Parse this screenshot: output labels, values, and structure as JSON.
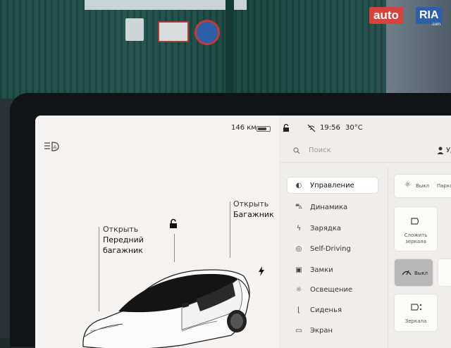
{
  "status_bar": {
    "range": "146 км",
    "battery_level": 0.75,
    "time": "19:56",
    "temperature": "30°C"
  },
  "left_panel": {
    "frunk_label_line1": "Открыть",
    "frunk_label_line2": "Передний",
    "frunk_label_line3": "багажник",
    "trunk_label_line1": "Открыть",
    "trunk_label_line2": "Багажник"
  },
  "right_panel": {
    "search_placeholder": "Поиск",
    "profile_label": "Уд",
    "menu": [
      {
        "icon": "toggle-icon",
        "label": "Управление",
        "active": true
      },
      {
        "icon": "car-icon",
        "label": "Динамика",
        "active": false
      },
      {
        "icon": "bolt-icon",
        "label": "Зарядка",
        "active": false
      },
      {
        "icon": "steering-wheel-icon",
        "label": "Self-Driving",
        "active": false
      },
      {
        "icon": "lock-icon",
        "label": "Замки",
        "active": false
      },
      {
        "icon": "sun-icon",
        "label": "Освещение",
        "active": false
      },
      {
        "icon": "seat-icon",
        "label": "Сиденья",
        "active": false
      },
      {
        "icon": "display-icon",
        "label": "Экран",
        "active": false
      }
    ],
    "cards": {
      "lights_off": "Выкл",
      "parking": "Парков",
      "fold_mirrors_line1": "Сложить",
      "fold_mirrors_line2": "зеркала",
      "wipers_off": "Выкл",
      "mirrors": "Зеркала"
    }
  },
  "watermark": {
    "brand_left": "auto",
    "brand_right": "RIA",
    "domain": ".com"
  },
  "colors": {
    "screen_bg": "#f1f0ef",
    "fence_green": "#1d4d47",
    "watermark_red": "#d9413b",
    "watermark_blue": "#2f5fa7"
  }
}
